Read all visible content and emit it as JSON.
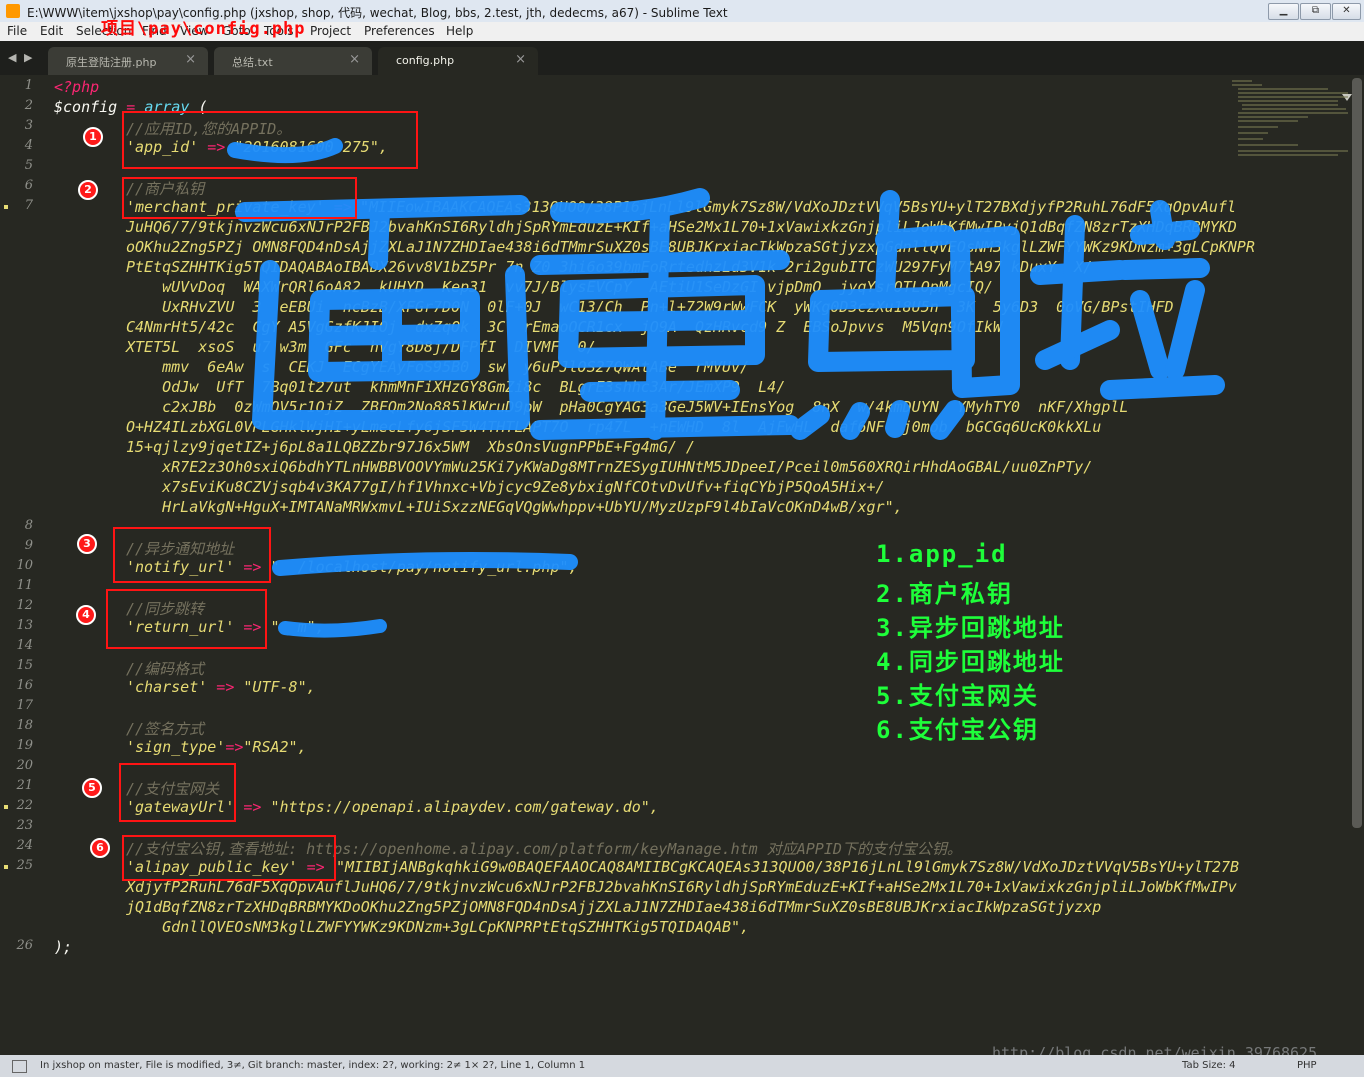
{
  "window": {
    "title": "E:\\WWW\\item\\jxshop\\pay\\config.php (jxshop, shop, 代码, wechat, Blog, bbs, 2.test, jth, dedecms, a67) - Sublime Text",
    "minimize": "▁",
    "maximize": "⧉",
    "close": "✕"
  },
  "menu": [
    "File",
    "Edit",
    "Selection",
    "Find",
    "View",
    "Goto",
    "Tools",
    "Project",
    "Preferences",
    "Help"
  ],
  "tabs": [
    {
      "label": "原生登陆注册.php",
      "close": "×"
    },
    {
      "label": "总结.txt",
      "close": "×"
    },
    {
      "label": "config.php",
      "close": "×"
    }
  ],
  "nav_arrows": "◀ ▶",
  "line_numbers": [
    "1",
    "2",
    "3",
    "4",
    "5",
    "6",
    "7",
    "8",
    "9",
    "10",
    "11",
    "12",
    "13",
    "14",
    "15",
    "16",
    "17",
    "18",
    "19",
    "20",
    "21",
    "22",
    "23",
    "24",
    "25",
    "26"
  ],
  "code": {
    "l1": "<?php",
    "l2_var": "$config",
    "l2_eq": " = ",
    "l2_fn": "array",
    "l2_paren": " (",
    "l3": "//应用ID,您的APPID。",
    "l4_key": "'app_id'",
    "l4_arrow": " => ",
    "l4_val": "\"2016081600 275\",",
    "l6": "//商户私钥",
    "l7_key": "'merchant_private_key'",
    "l7_arrow": " => ",
    "private_key_lines": [
      "\"MIIEowIBAAKCAQEAs313QUO0/38P16jLnLl9lGmyk7Sz8W/VdXoJDztVVqV5BsYU+ylT27BXdjyfP2RuhL76dF5XqOpvAufl",
      "JuHQ6/7/9tkjnvzWcu6xNJrP2FBJ2bvahKnSI6RyldhjSpRYmEduzE+KIf+aHSe2Mx1L70+1xVawixkzGnjpliLJoWbKfMwIPvjQ1dBqfZN8zrTzXHDqBRBMYKD",
      "oOKhu2Zng5PZj OMN8FQD4nDsAjjZXLaJ1N7ZHDIae438i6dTMmrSuXZ0sBE8UBJKrxiacIkWpzaSGtjyzxpGdnllQVEOsNM3kglLZWFYYWKz9KDNzm+3gLCpKNPR",
      "PtEtqSZHHTKig5TQIDAQABAoIBADX26vv8V1bZ5Pr 7n Z0 3hi6o39bmEoRrtedhzLd3V1k 2ri2gubITCzWU297FyM7tA97 kDuxY  X/",
      "    wUVvDoq  WAXWrQRl6oA82  kUHYD  Kep31  vv7J/BlysEVCpY  AEtiU1SeDzGI vjpDmO  jyqYsrOTLOpMgcIQ/",
      "    UxRHvZVU  3  eEBUi  ncBzB/XFGr7D0N  0lF+0J  wC13/Ch  Pn+l+72W9rWwFCK  yWKg0D3czXu18U5n  3K  5y6D3  0oVG/BPstIHFD",
      "C4NmrHt5/42c  CgY A5VgGzfKJIOj  dxZqOk  3C  rEmaoOCR1cx  jO9A  QzHRvcd9 Z  EBSoJpvvs  M5Vqn9OfIkW",
      "XTET5L  xsoS  u7 w3m  GFc  hVgY8D8j/DFPfI  DIVMF  0/",
      "    mmv  6eAw  s  CEKJ  ECgYEAyFoS95B0  sw  y6uPJlOS27QWAtABe  rMVUv/",
      "    OdJw  UfT  7Bq01t27ut  khmMnFiXHzGY8GmZi8c  BLgrE3shhc3Ar/JEmXP9  L4/",
      "    c2xJBb  0zWmOV5r1OjZ  ZBFQm2No885lKWruD9pW  pHa0CgYAG3a3GeJ5WV+IEnsYog  8nX  w/4kmDUYN  YMyhTY0  nKF/XhgplL",
      "O+HZ4ILzbXGL0VPLGHklWjHI+yLmecLfy6jSF5W4THTLAPT7O  rp47L  +nEWHD  8l  AjFwHL  daf6NF  j0mob  bGCGq6UcK0kkXLu",
      "15+qjlzy9jqetIZ+j6pL8a1LQBZZbr97J6x5WM  XbsOnsVugnPPbE+Fg4mG/ /",
      "    xR7E2z3Oh0sxiQ6bdhYTLnHWBBVOOVYmWu25Ki7yKWaDg8MTrnZESygIUHNtM5JDpeeI/Pceil0m560XRQirHhdAoGBAL/uu0ZnPTy/",
      "    x7sEviKu8CZVjsqb4v3KA77gI/hf1Vhnxc+Vbjcyc9Ze8ybxigNfCOtvDvUfv+fiqCYbjP5QoA5Hix+/",
      "    HrLaVkgN+HguX+IMTANaMRWxmvL+IUiSxzzNEGqVQgWwhppv+UbYU/MyzUzpF9l4bIaVcOKnD4wB/xgr\","
    ],
    "l9": "//异步通知地址",
    "l10_key": "'notify_url'",
    "l10_arrow": " => ",
    "l10_val": "\"  /localhost/pay/notify_url.php\",",
    "l12": "//同步跳转",
    "l13_key": "'return_url'",
    "l13_arrow": " => ",
    "l13_val": "\"  m\",",
    "l15": "//编码格式",
    "l16_key": "'charset'",
    "l16_arrow": " => ",
    "l16_val": "\"UTF-8\",",
    "l18": "//签名方式",
    "l19_key": "'sign_type'",
    "l19_arrow": "=>",
    "l19_val": "\"RSA2\",",
    "l21": "//支付宝网关",
    "l22_key": "'gatewayUrl'",
    "l22_arrow": " => ",
    "l22_val": "\"https://openapi.alipaydev.com/gateway.do\",",
    "l24": "//支付宝公钥,查看地址: https://openhome.alipay.com/platform/keyManage.htm 对应APPID下的支付宝公钥。",
    "l25_key": "'alipay_public_key'",
    "l25_arrow": " => ",
    "public_key_lines": [
      "\"MIIBIjANBgkqhkiG9w0BAQEFAAOCAQ8AMIIBCgKCAQEAs313QUO0/38P16jLnLl9lGmyk7Sz8W/VdXoJDztVVqV5BsYU+ylT27B",
      "XdjyfP2RuhL76dF5XqOpvAuflJuHQ6/7/9tkjnvzWcu6xNJrP2FBJ2bvahKnSI6RyldhjSpRYmEduzE+KIf+aHSe2Mx1L70+1xVawixkzGnjpliLJoWbKfMwIPv",
      "jQ1dBqfZN8zrTzXHDqBRBMYKDoOKhu2Zng5PZjOMN8FQD4nDsAjjZXLaJ1N7ZHDIae438i6dTMmrSuXZ0sBE8UBJKrxiacIkWpzaSGtjyzxp",
      "    GdnllQVEOsNM3kglLZWFYYWKz9KDNzm+3gLCpKNPRPtEtqSZHHTKig5TQIDAQAB\","
    ],
    "l26": ");"
  },
  "annotations": {
    "path_note": "项目\\pay\\config.php",
    "numbers": [
      "1",
      "2",
      "3",
      "4",
      "5",
      "6"
    ],
    "legend": [
      "1.app_id",
      "2.商户私钥",
      "3.异步回跳地址",
      "4.同步回跳地址",
      "5.支付宝网关",
      "6.支付宝公钥"
    ],
    "red": "#ff1414",
    "green": "#1eff3a",
    "blue": "#1e8fff"
  },
  "status": {
    "text": "In jxshop on master, File is modified, 3≠, Git branch: master, index: 2?, working: 2≠ 1× 2?, Line 1, Column 1",
    "tab_size": "Tab Size: 4",
    "syntax": "PHP"
  },
  "watermark": "http://blog.csdn.net/weixin_39768625"
}
